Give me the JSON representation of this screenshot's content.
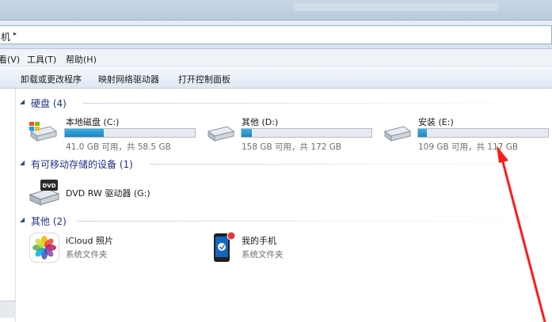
{
  "address": {
    "crumb": "机",
    "arrow": "▸"
  },
  "menu": [
    {
      "label": "看(V)"
    },
    {
      "label": "工具(T)"
    },
    {
      "label": "帮助(H)"
    }
  ],
  "commands": [
    {
      "label": "卸载或更改程序"
    },
    {
      "label": "映射网络驱动器"
    },
    {
      "label": "打开控制面板"
    }
  ],
  "groups": {
    "hard_disks": {
      "title": "硬盘 (4)"
    },
    "removable": {
      "title": "有可移动存储的设备 (1)"
    },
    "other": {
      "title": "其他 (2)"
    }
  },
  "drives": [
    {
      "name": "本地磁盘 (C:)",
      "info": "41.0 GB 可用，共 58.5 GB",
      "used_fraction": 0.3
    },
    {
      "name": "其他 (D:)",
      "info": "158 GB 可用，共 172 GB",
      "used_fraction": 0.08
    },
    {
      "name": "安装 (E:)",
      "info": "109 GB 可用，共 117 GB",
      "used_fraction": 0.07
    }
  ],
  "removable_devices": [
    {
      "name": "DVD RW 驱动器 (G:)",
      "icon": "dvd-drive-icon"
    }
  ],
  "other_items": [
    {
      "name": "iCloud 照片",
      "sub": "系统文件夹",
      "icon": "icloud-photos-icon"
    },
    {
      "name": "我的手机",
      "sub": "系统文件夹",
      "icon": "phone-icon"
    }
  ],
  "colors": {
    "group_title": "#1e3287",
    "bar_fill": "#1b86c0",
    "annotation_arrow": "#ff1a1a"
  }
}
